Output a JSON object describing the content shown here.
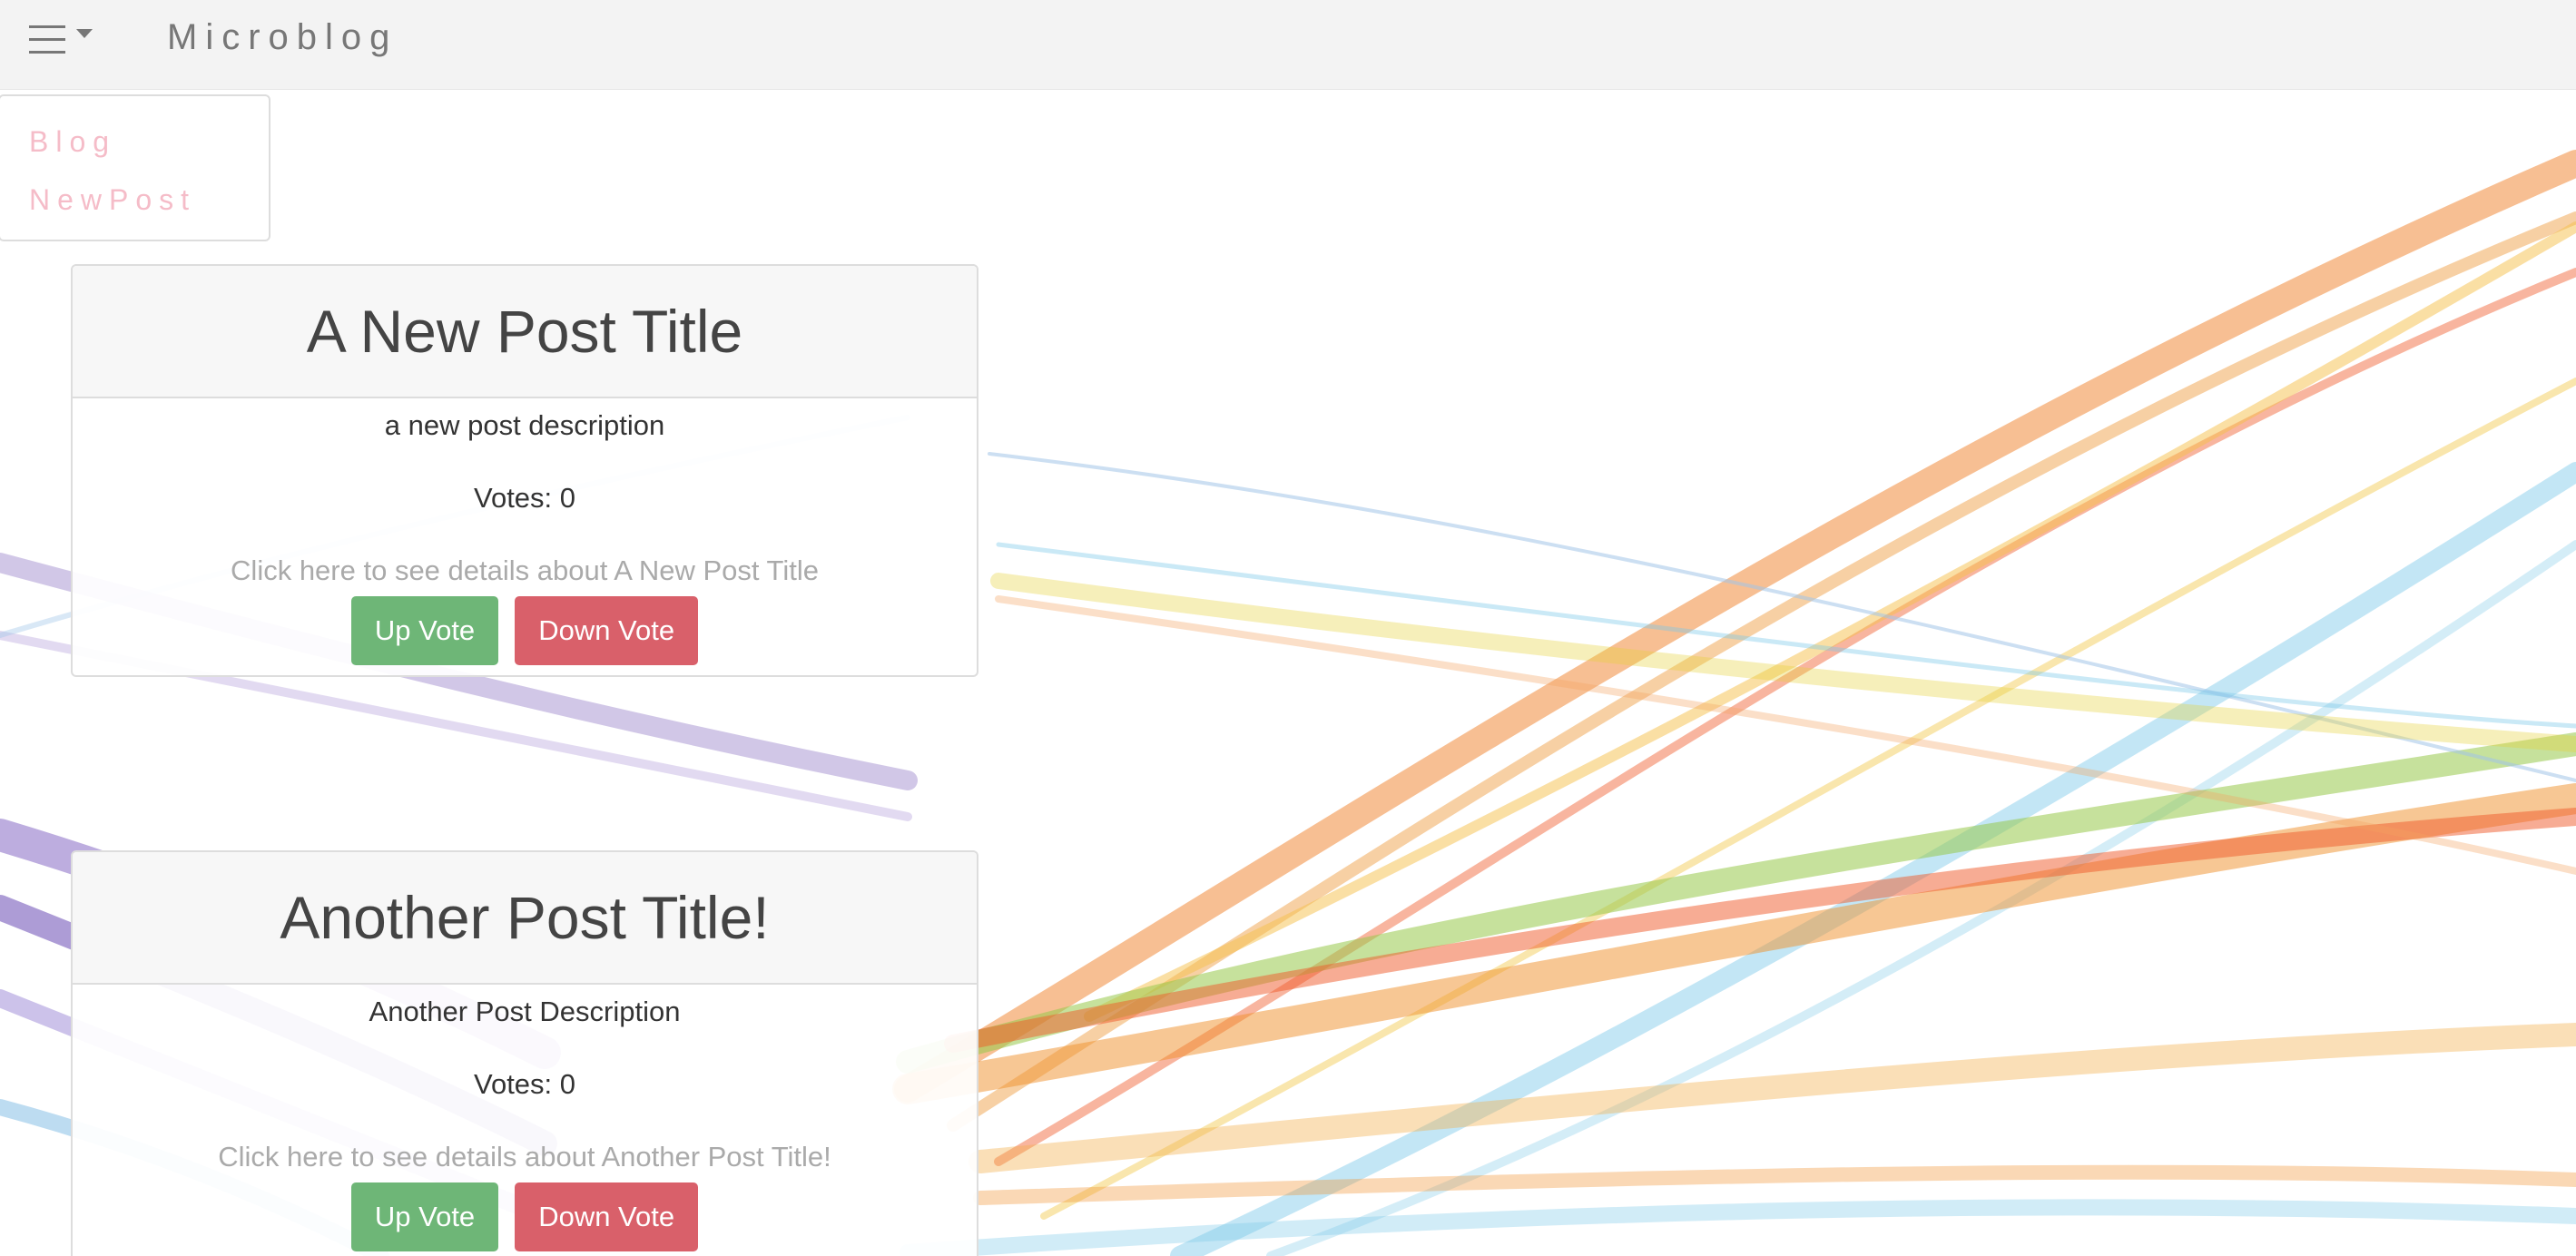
{
  "navbar": {
    "brand": "Microblog",
    "menu_icon": "hamburger-menu-icon",
    "caret_icon": "caret-down-icon",
    "background": "#f3f3f3"
  },
  "dropdown": {
    "items": [
      {
        "label": "Blog"
      },
      {
        "label": "NewPost"
      }
    ],
    "item_color": "#f5bcc8"
  },
  "posts": [
    {
      "title": "A New Post Title",
      "description": "a new post description",
      "votes": "Votes: 0",
      "details_link": "Click here to see details about A New Post Title",
      "upvote_label": "Up Vote",
      "downvote_label": "Down Vote"
    },
    {
      "title": "Another Post Title!",
      "description": "Another Post Description",
      "votes": "Votes: 0",
      "details_link": "Click here to see details about Another Post Title!",
      "upvote_label": "Up Vote",
      "downvote_label": "Down Vote"
    }
  ],
  "colors": {
    "upvote": "#6eb677",
    "downvote": "#d9606a",
    "link": "#aaaaaa"
  }
}
